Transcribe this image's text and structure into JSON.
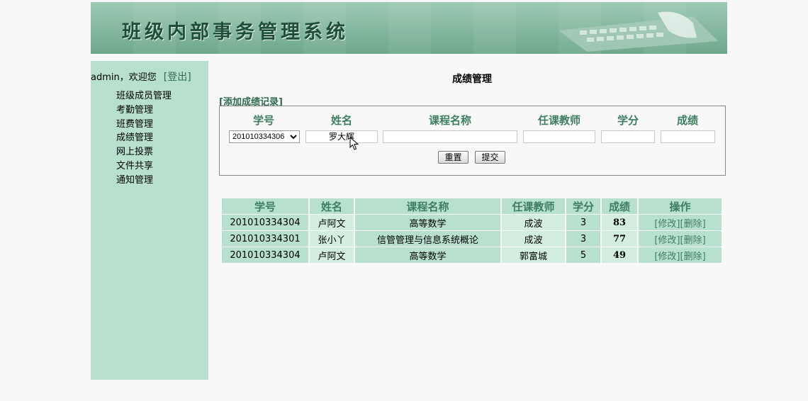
{
  "header": {
    "title": "班级内部事务管理系统"
  },
  "user": {
    "greeting": "admin，欢迎您",
    "logout": "[登出]"
  },
  "nav": [
    "班级成员管理",
    "考勤管理",
    "班费管理",
    "成绩管理",
    "网上投票",
    "文件共享",
    "通知管理"
  ],
  "page": {
    "title": "成绩管理",
    "add_link": "[添加成绩记录]"
  },
  "form": {
    "headers": [
      "学号",
      "姓名",
      "课程名称",
      "任课教师",
      "学分",
      "成绩"
    ],
    "student_id": "201010334306",
    "name": "罗大辉",
    "course": "",
    "teacher": "",
    "credit": "",
    "score": "",
    "reset": "重置",
    "submit": "提交"
  },
  "table": {
    "headers": [
      "学号",
      "姓名",
      "课程名称",
      "任课教师",
      "学分",
      "成绩",
      "操作"
    ],
    "rows": [
      {
        "id": "201010334304",
        "name": "卢阿文",
        "course": "高等数学",
        "teacher": "成波",
        "credit": "3",
        "score": "83",
        "edit": "[修改]",
        "del": "[删除]"
      },
      {
        "id": "201010334301",
        "name": "张小丫",
        "course": "信管管理与信息系统概论",
        "teacher": "成波",
        "credit": "3",
        "score": "77",
        "edit": "[修改]",
        "del": "[删除]"
      },
      {
        "id": "201010334304",
        "name": "卢阿文",
        "course": "高等数学",
        "teacher": "郭富城",
        "credit": "5",
        "score": "49",
        "edit": "[修改]",
        "del": "[删除]"
      }
    ]
  }
}
